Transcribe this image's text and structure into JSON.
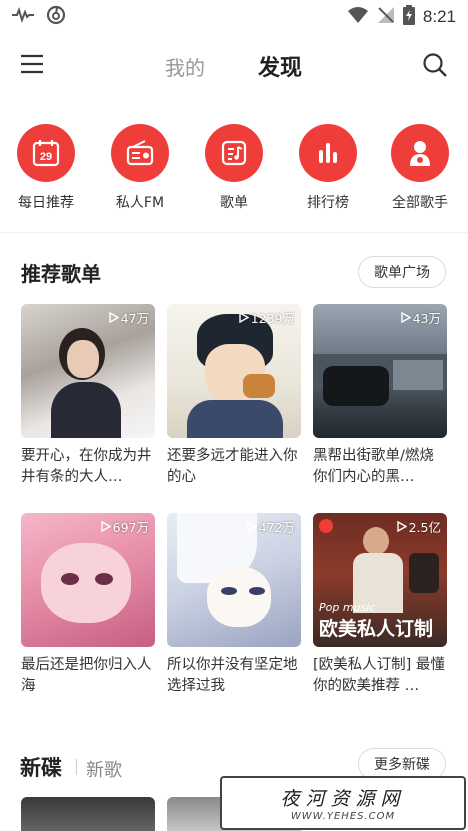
{
  "status_bar": {
    "time": "8:21",
    "icons": [
      "activity-icon",
      "netease-icon",
      "wifi-icon",
      "signal-off-icon",
      "battery-charging-icon"
    ]
  },
  "top_nav": {
    "tab_mine": "我的",
    "tab_discover": "发现",
    "active_tab": "发现"
  },
  "quick_nav": {
    "items": [
      {
        "label": "每日推荐",
        "icon": "calendar-icon",
        "badge": "29"
      },
      {
        "label": "私人FM",
        "icon": "radio-icon"
      },
      {
        "label": "歌单",
        "icon": "playlist-icon"
      },
      {
        "label": "排行榜",
        "icon": "chart-bars-icon"
      },
      {
        "label": "全部歌手",
        "icon": "singer-icon"
      }
    ],
    "accent": "#ef3e3a"
  },
  "recommended": {
    "title": "推荐歌单",
    "more_label": "歌单广场",
    "cards": [
      {
        "play_count": "47万",
        "title": "要开心，在你成为井井有条的大人…"
      },
      {
        "play_count": "1239万",
        "title": "还要多远才能进入你的心"
      },
      {
        "play_count": "43万",
        "title": "黑帮出街歌单/燃烧你们内心的黑…"
      },
      {
        "play_count": "697万",
        "title": "最后还是把你归入人海"
      },
      {
        "play_count": "472万",
        "title": "所以你并没有坚定地选择过我"
      },
      {
        "play_count": "2.5亿",
        "title": "[欧美私人订制] 最懂你的欧美推荐 …",
        "overlay_small": "Pop music",
        "overlay_big": "欧美私人订制"
      }
    ]
  },
  "new_section": {
    "tab_new_disc": "新碟",
    "tab_new_song": "新歌",
    "more_label": "更多新碟"
  },
  "watermark": {
    "text": "夜河资源网",
    "url": "WWW.YEHES.COM"
  }
}
